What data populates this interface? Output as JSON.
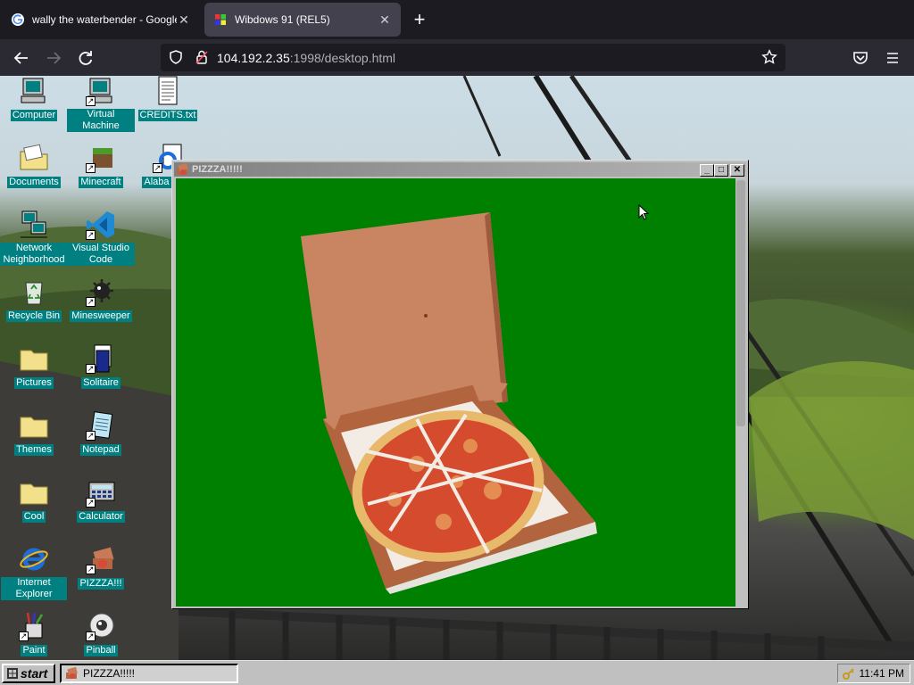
{
  "browser": {
    "tabs": [
      {
        "title": "wally the waterbender - Google",
        "favicon": "google-icon",
        "active": false
      },
      {
        "title": "Wibdows 91 (REL5)",
        "favicon": "windows-logo-icon",
        "active": true
      }
    ],
    "new_tab": "+",
    "url_host": "104.192.2.35",
    "url_rest": ":1998/desktop.html"
  },
  "desktop": {
    "icons": [
      {
        "label": "Computer",
        "icon": "computer-icon"
      },
      {
        "label": "Virtual Machine",
        "icon": "computer-icon",
        "shortcut": true
      },
      {
        "label": "CREDITS.txt",
        "icon": "text-file-icon"
      },
      {
        "label": "Documents",
        "icon": "folder-documents-icon"
      },
      {
        "label": "Minecraft",
        "icon": "minecraft-icon",
        "shortcut": true
      },
      {
        "label": "Alaba KFC",
        "icon": "internet-explorer-icon",
        "shortcut": true
      },
      {
        "label": "Network Neighborhood",
        "icon": "network-icon"
      },
      {
        "label": "Visual Studio Code",
        "icon": "vscode-icon",
        "shortcut": true
      },
      {
        "label": "Recycle Bin",
        "icon": "recycle-bin-icon"
      },
      {
        "label": "Minesweeper",
        "icon": "minesweeper-icon",
        "shortcut": true
      },
      {
        "label": "Pictures",
        "icon": "folder-icon"
      },
      {
        "label": "Solitaire",
        "icon": "solitaire-icon",
        "shortcut": true
      },
      {
        "label": "Themes",
        "icon": "folder-icon"
      },
      {
        "label": "Notepad",
        "icon": "notepad-icon",
        "shortcut": true
      },
      {
        "label": "Cool",
        "icon": "folder-icon"
      },
      {
        "label": "Calculator",
        "icon": "calculator-icon",
        "shortcut": true
      },
      {
        "label": "Internet Explorer",
        "icon": "internet-explorer-icon"
      },
      {
        "label": "PIZZZA!!!",
        "icon": "pizza-icon",
        "shortcut": true
      },
      {
        "label": "Paint",
        "icon": "paint-icon",
        "shortcut": true
      },
      {
        "label": "Pinball",
        "icon": "pinball-icon",
        "shortcut": true
      }
    ]
  },
  "window": {
    "title": "PIZZZA!!!!!",
    "minimize": "_",
    "maximize": "□",
    "close": "✕",
    "content_bg": "#008000"
  },
  "taskbar": {
    "start_label": "start",
    "task_label": "PIZZZA!!!!!",
    "clock": "11:41 PM"
  }
}
